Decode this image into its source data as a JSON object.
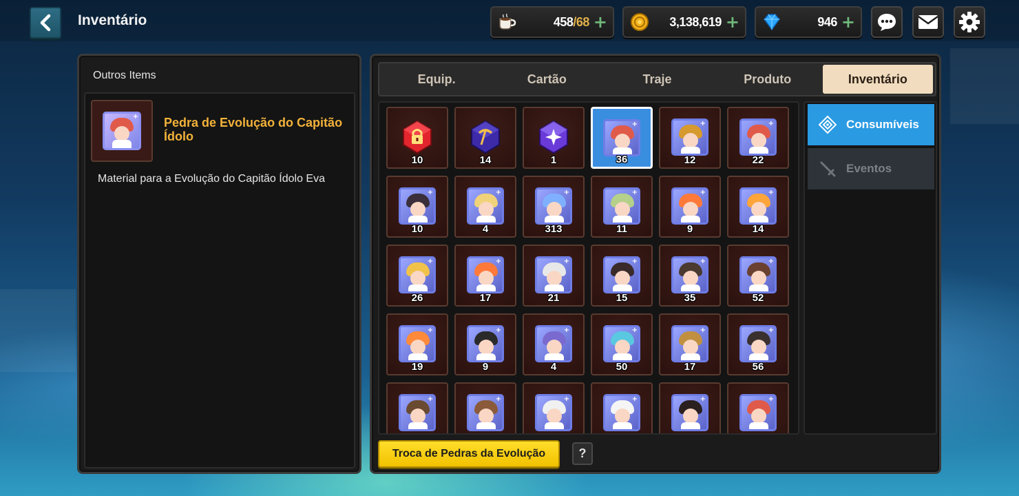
{
  "header": {
    "title": "Inventário",
    "back_icon": "chevron-left-icon"
  },
  "resources": {
    "stamina": {
      "icon": "coffee-cup-icon",
      "current": "458",
      "max": "/68",
      "plus": "+"
    },
    "meso": {
      "icon": "gold-coin-icon",
      "value": "3,138,619",
      "plus": "+"
    },
    "crystal": {
      "icon": "blue-diamond-icon",
      "value": "946",
      "plus": "+"
    }
  },
  "top_buttons": [
    "chat-bubble-icon",
    "mail-icon",
    "settings-gear-icon"
  ],
  "left_panel": {
    "header": "Outros Items",
    "item_name": "Pedra de Evolução do Capitão Ídolo",
    "item_description": "Material para a Evolução do Capitão Ídolo Eva"
  },
  "tabs": [
    {
      "label": "Equip.",
      "active": false
    },
    {
      "label": "Cartão",
      "active": false
    },
    {
      "label": "Traje",
      "active": false
    },
    {
      "label": "Produto",
      "active": false
    },
    {
      "label": "Inventário",
      "active": true
    }
  ],
  "side_tabs": [
    {
      "label": "Consumíveis",
      "icon": "diamond-grid-icon",
      "active": true
    },
    {
      "label": "Eventos",
      "icon": "sword-icon",
      "active": false
    }
  ],
  "items": [
    {
      "name": "red-lock-gem",
      "qty": "10"
    },
    {
      "name": "purple-pickaxe-gem",
      "qty": "14"
    },
    {
      "name": "purple-star-gem",
      "qty": "1"
    },
    {
      "name": "captain-idol-evolution-stone",
      "qty": "36",
      "selected": true
    },
    {
      "name": "evolution-stone",
      "qty": "12"
    },
    {
      "name": "evolution-stone",
      "qty": "22"
    },
    {
      "name": "evolution-stone",
      "qty": "10"
    },
    {
      "name": "evolution-stone",
      "qty": "4"
    },
    {
      "name": "evolution-stone",
      "qty": "313"
    },
    {
      "name": "evolution-stone",
      "qty": "11"
    },
    {
      "name": "evolution-stone",
      "qty": "9"
    },
    {
      "name": "evolution-stone",
      "qty": "14"
    },
    {
      "name": "evolution-stone",
      "qty": "26"
    },
    {
      "name": "evolution-stone",
      "qty": "17"
    },
    {
      "name": "evolution-stone",
      "qty": "21"
    },
    {
      "name": "evolution-stone",
      "qty": "15"
    },
    {
      "name": "evolution-stone",
      "qty": "35"
    },
    {
      "name": "evolution-stone",
      "qty": "52"
    },
    {
      "name": "evolution-stone",
      "qty": "19"
    },
    {
      "name": "evolution-stone",
      "qty": "9"
    },
    {
      "name": "evolution-stone",
      "qty": "4"
    },
    {
      "name": "evolution-stone",
      "qty": "50"
    },
    {
      "name": "evolution-stone",
      "qty": "17"
    },
    {
      "name": "evolution-stone",
      "qty": "56"
    },
    {
      "name": "evolution-stone",
      "qty": ""
    },
    {
      "name": "evolution-stone",
      "qty": ""
    },
    {
      "name": "evolution-stone",
      "qty": ""
    },
    {
      "name": "evolution-stone",
      "qty": ""
    },
    {
      "name": "evolution-stone",
      "qty": ""
    },
    {
      "name": "evolution-stone",
      "qty": ""
    }
  ],
  "footer": {
    "exchange_button": "Troca de Pedras da Evolução",
    "help_button": "?"
  },
  "colors": {
    "accent_gold": "#f2b23a",
    "tab_active_bg": "#f1dcbf",
    "side_tab_active": "#2a9ae2",
    "exchange_yellow": "#ffd21a",
    "selected_cell": "#3a8ee0"
  }
}
